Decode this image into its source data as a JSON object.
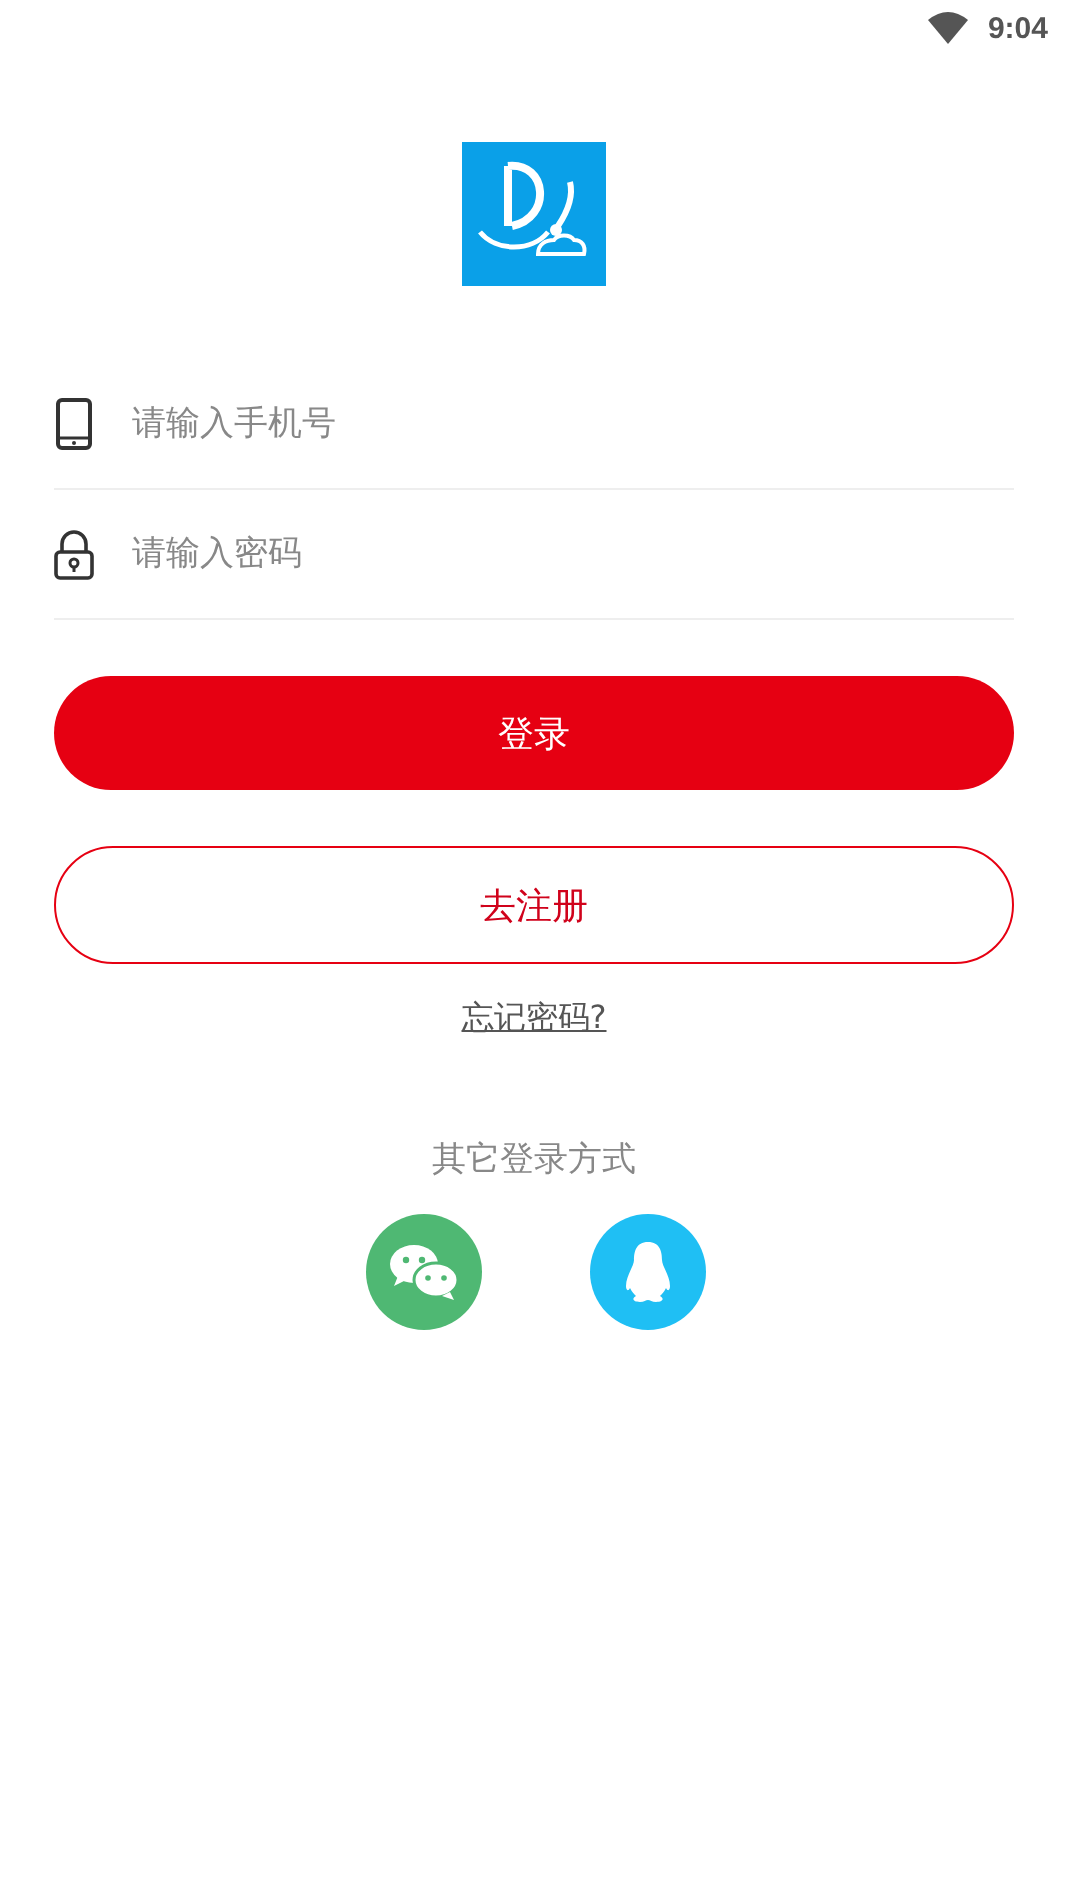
{
  "status_bar": {
    "time": "9:04"
  },
  "fields": [
    {
      "kind": "phone",
      "placeholder": "请输入手机号"
    },
    {
      "kind": "password",
      "placeholder": "请输入密码"
    }
  ],
  "login_button": "登录",
  "register_button": "去注册",
  "forgot_link": "忘记密码?",
  "other_login": {
    "title": "其它登录方式",
    "options": [
      {
        "kind": "chat"
      },
      {
        "kind": "penguin"
      }
    ]
  }
}
